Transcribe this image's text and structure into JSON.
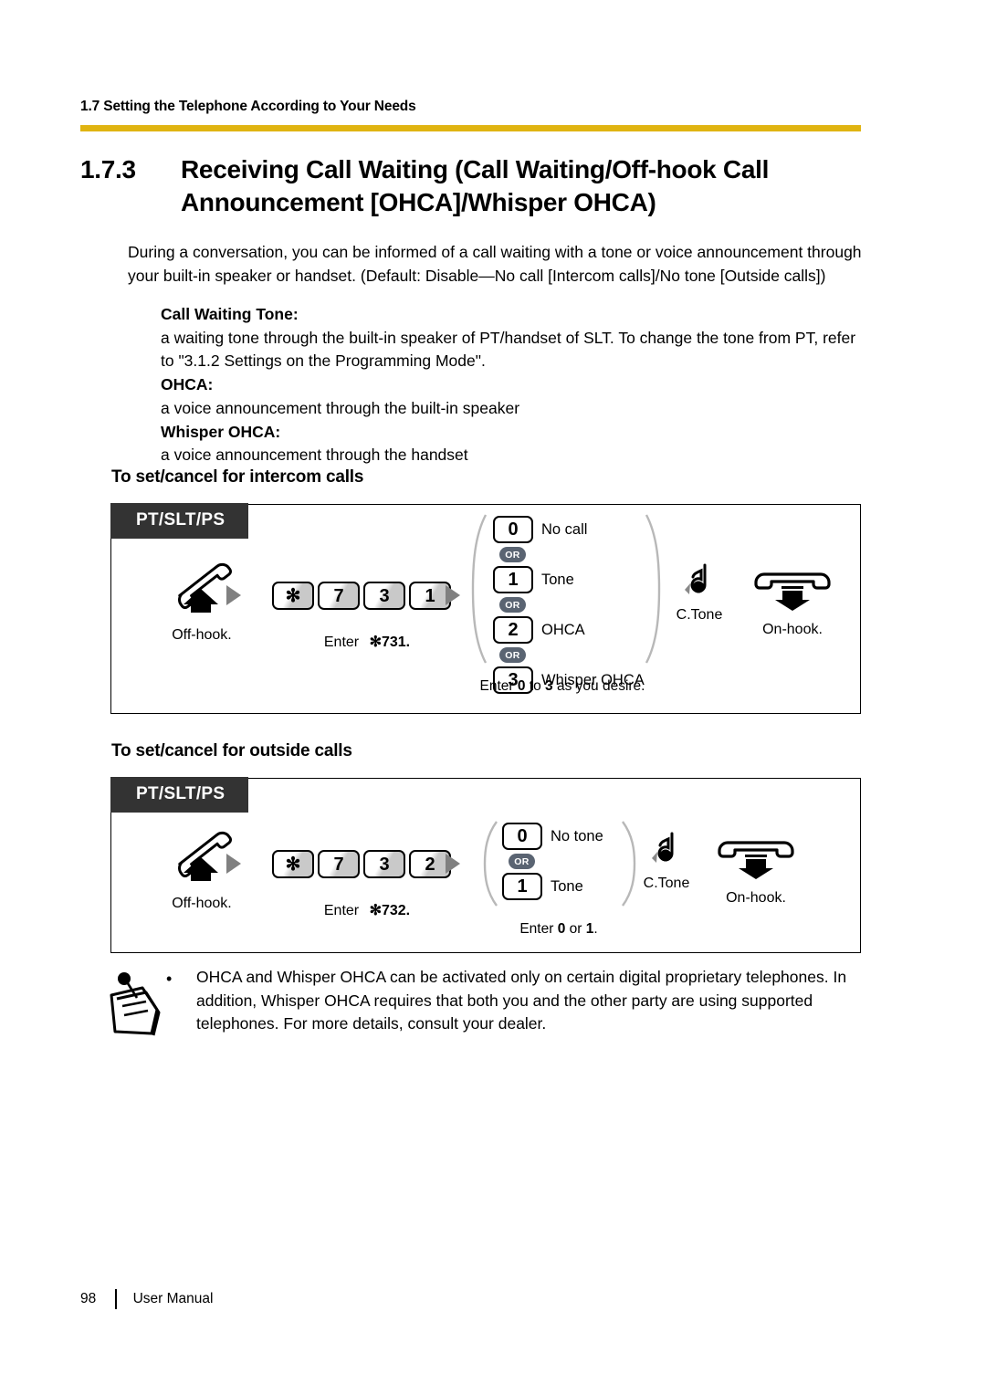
{
  "header": {
    "running_head": "1.7 Setting the Telephone According to Your Needs",
    "rule_color": "#E0B411"
  },
  "title": {
    "number": "1.7.3",
    "text": "Receiving Call Waiting (Call Waiting/Off-hook Call Announcement [OHCA]/Whisper OHCA)"
  },
  "intro": "During a conversation, you can be informed of a call waiting with a tone or voice announcement through your built-in speaker or handset. (Default: Disable—No call [Intercom calls]/No tone [Outside calls])",
  "definitions": [
    {
      "term": "Call Waiting Tone:",
      "def": "a waiting tone through the built-in speaker of PT/handset of SLT. To change the tone from PT, refer to \"3.1.2 Settings on the Programming Mode\"."
    },
    {
      "term": "OHCA:",
      "def": "a voice announcement through the built-in speaker"
    },
    {
      "term": "Whisper OHCA:",
      "def": "a voice announcement through the handset"
    }
  ],
  "sections": [
    {
      "id": "intercom",
      "subhead": "To set/cancel for intercom calls",
      "device_tab": "PT/SLT/PS",
      "offhook_caption": "Off-hook.",
      "enter_label": "Enter",
      "enter_code": "✻731.",
      "keys": [
        "✻",
        "7",
        "3",
        "1"
      ],
      "options": [
        {
          "key": "0",
          "label": "No call"
        },
        {
          "key": "1",
          "label": "Tone"
        },
        {
          "key": "2",
          "label": "OHCA"
        },
        {
          "key": "3",
          "label": "Whisper OHCA"
        }
      ],
      "or_label": "OR",
      "hint_prefix": "Enter ",
      "hint_first": "0",
      "hint_middle": " to ",
      "hint_second": "3",
      "hint_suffix": " as you desire.",
      "ctone_caption": "C.Tone",
      "onhook_caption": "On-hook."
    },
    {
      "id": "outside",
      "subhead": "To set/cancel for outside calls",
      "device_tab": "PT/SLT/PS",
      "offhook_caption": "Off-hook.",
      "enter_label": "Enter",
      "enter_code": "✻732.",
      "keys": [
        "✻",
        "7",
        "3",
        "2"
      ],
      "options": [
        {
          "key": "0",
          "label": "No tone"
        },
        {
          "key": "1",
          "label": "Tone"
        }
      ],
      "or_label": "OR",
      "hint_prefix": "Enter ",
      "hint_first": "0",
      "hint_middle": " or ",
      "hint_second": "1",
      "hint_suffix": ".",
      "ctone_caption": "C.Tone",
      "onhook_caption": "On-hook."
    }
  ],
  "note": {
    "bullet": "•",
    "text": "OHCA and Whisper OHCA can be activated only on certain digital proprietary telephones. In addition, Whisper OHCA requires that both you and the other party are using supported telephones. For more details, consult your dealer."
  },
  "footer": {
    "page_number": "98",
    "doc_title": "User Manual"
  }
}
